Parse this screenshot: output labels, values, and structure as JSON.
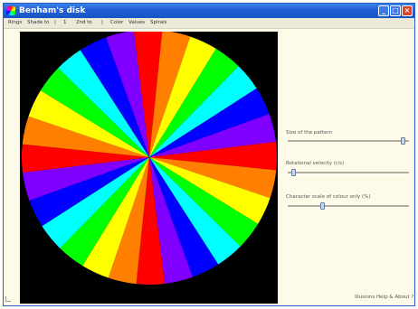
{
  "window": {
    "title": "Benham's disk",
    "minimize_glyph": "_",
    "maximize_glyph": "□",
    "close_glyph": "×"
  },
  "menu": {
    "items": [
      "Rings",
      "Shade to",
      "1",
      "2nd to",
      "Color",
      "Values",
      "Spirals"
    ],
    "separators": [
      "|",
      "|"
    ]
  },
  "pinwheel": {
    "background": "#000000",
    "colors": [
      "#ff0000",
      "#ff8000",
      "#ffff00",
      "#00ff00",
      "#00ffff",
      "#0000ff",
      "#8000ff"
    ],
    "segments": 28
  },
  "controls": {
    "slider1": {
      "label": "Size of the pattern",
      "value": 0.97
    },
    "slider2": {
      "label": "Rotational velocity (r/s)",
      "value": 0.03
    },
    "slider3": {
      "label": "Character scale of colour only (%)",
      "value": 0.28
    }
  },
  "footer": {
    "link": "Illusions Help & About ?"
  }
}
